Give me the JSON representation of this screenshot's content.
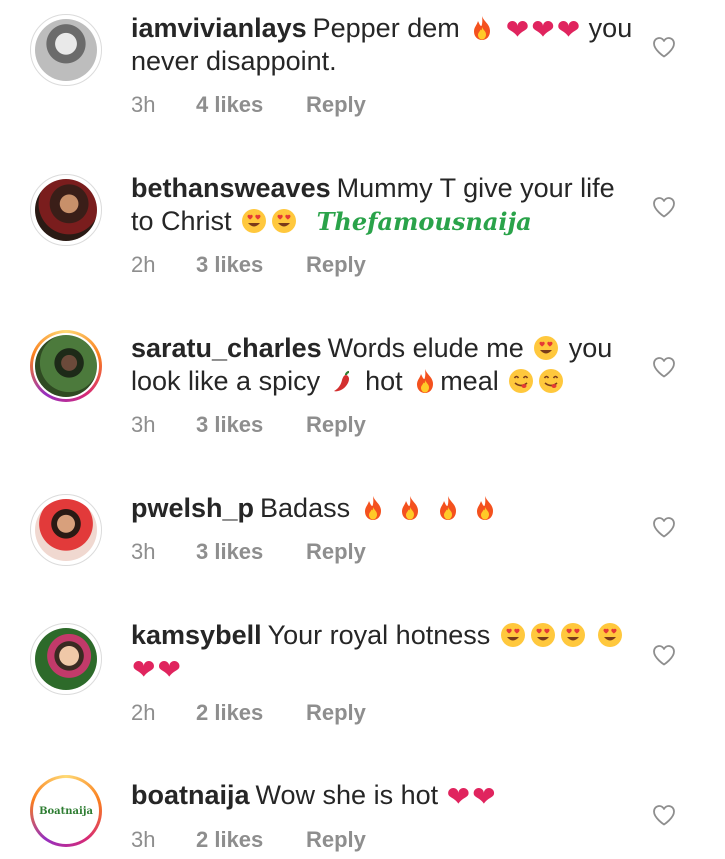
{
  "comments": [
    {
      "username": "iamvivianlays",
      "text_before": "Pepper dem",
      "text_after": "you never disappoint.",
      "time": "3h",
      "likes": "4 likes",
      "reply": "Reply",
      "story_ring": false
    },
    {
      "username": "bethansweaves",
      "text_before": "Mummy T give your life to Christ",
      "watermark": "Thefamousnaija",
      "time": "2h",
      "likes": "3 likes",
      "reply": "Reply",
      "story_ring": false
    },
    {
      "username": "saratu_charles",
      "text_before": "Words elude me",
      "text_mid1": "you look like a spicy",
      "text_mid2": "hot",
      "text_mid3": "meal",
      "time": "3h",
      "likes": "3 likes",
      "reply": "Reply",
      "story_ring": true
    },
    {
      "username": "pwelsh_p",
      "text_before": "Badass",
      "time": "3h",
      "likes": "3 likes",
      "reply": "Reply",
      "story_ring": false
    },
    {
      "username": "kamsybell",
      "text_before": "Your royal hotness",
      "time": "2h",
      "likes": "2 likes",
      "reply": "Reply",
      "story_ring": false
    },
    {
      "username": "boatnaija",
      "text_before": "Wow she is hot",
      "avatar_logo": "Boatnaija",
      "time": "3h",
      "likes": "2 likes",
      "reply": "Reply",
      "story_ring": true
    }
  ],
  "icons": {
    "like": "heart-outline-icon",
    "fire": "fire-emoji",
    "heart": "pink-heart-emoji",
    "heart_eyes": "heart-eyes-emoji",
    "yum": "yum-emoji",
    "chili": "chili-pepper-emoji"
  },
  "colors": {
    "username": "#262626",
    "meta": "#8e8e8e",
    "heart_emoji": "#e0245e",
    "watermark": "#2aa34a"
  }
}
